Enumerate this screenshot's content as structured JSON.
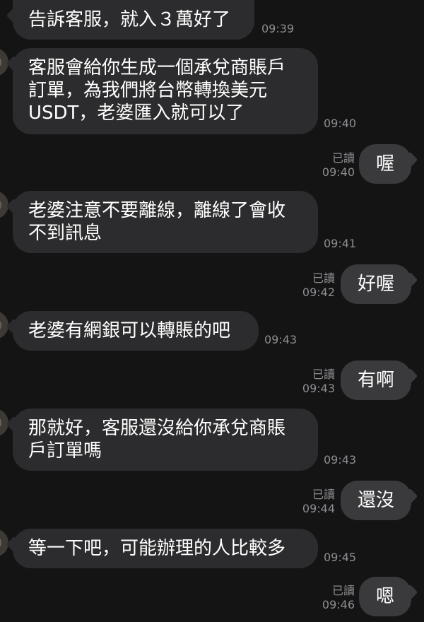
{
  "messages": [
    {
      "text": "告訴客服，就入３萬好了",
      "time": "09:39"
    },
    {
      "text": "客服會給你生成一個承兌商賬戶\n訂單，為我們將台幣轉換美元\nUSDT，老婆匯入就可以了",
      "time": "09:40"
    },
    {
      "text": "喔",
      "time": "09:40",
      "read": "已讀"
    },
    {
      "text": "老婆注意不要離線，離線了會收\n不到訊息",
      "time": "09:41"
    },
    {
      "text": "好喔",
      "time": "09:42",
      "read": "已讀"
    },
    {
      "text": "老婆有網銀可以轉賬的吧",
      "time": "09:43"
    },
    {
      "text": "有啊",
      "time": "09:43",
      "read": "已讀"
    },
    {
      "text": "那就好，客服還沒給你承兌商賬\n戶訂單嗎",
      "time": "09:43"
    },
    {
      "text": "還沒",
      "time": "09:44",
      "read": "已讀"
    },
    {
      "text": "等一下吧，可能辦理的人比較多",
      "time": "09:45"
    },
    {
      "text": "嗯",
      "time": "09:46",
      "read": "已讀"
    }
  ]
}
